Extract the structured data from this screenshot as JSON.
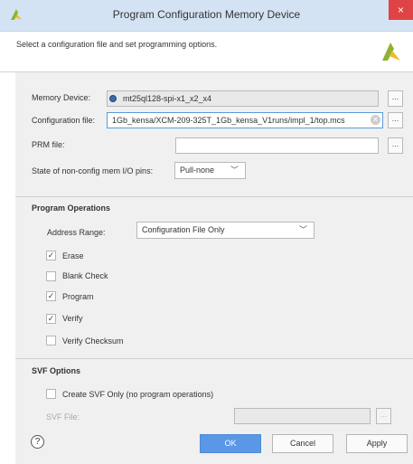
{
  "window": {
    "title": "Program Configuration Memory Device",
    "close_glyph": "×"
  },
  "header": {
    "subtitle": "Select a configuration file and set programming options."
  },
  "form": {
    "memory_device_label": "Memory Device:",
    "memory_device_value": "mt25ql128-spi-x1_x2_x4",
    "config_file_label": "Configuration file:",
    "config_file_value": "1Gb_kensa/XCM-209-325T_1Gb_kensa_V1runs/impl_1/top.mcs",
    "prm_file_label": "PRM file:",
    "prm_file_value": "",
    "state_pins_label": "State of non-config mem I/O pins:",
    "state_pins_value": "Pull-none",
    "browse_glyph": "..."
  },
  "program_operations": {
    "title": "Program Operations",
    "address_range_label": "Address Range:",
    "address_range_value": "Configuration File Only",
    "options": [
      {
        "label": "Erase",
        "checked": true
      },
      {
        "label": "Blank Check",
        "checked": false
      },
      {
        "label": "Program",
        "checked": true
      },
      {
        "label": "Verify",
        "checked": true
      },
      {
        "label": "Verify Checksum",
        "checked": false
      }
    ]
  },
  "svf_options": {
    "title": "SVF Options",
    "create_svf_label": "Create SVF Only (no program operations)",
    "svf_file_label": "SVF File:",
    "svf_file_value": ""
  },
  "buttons": {
    "help": "?",
    "ok": "OK",
    "cancel": "Cancel",
    "apply": "Apply"
  },
  "icons": {
    "app": "vivado-logo-icon",
    "memory": "gear-icon",
    "clear": "clear-icon",
    "dropdown": "chevron-down-icon"
  },
  "colors": {
    "title_bar": "#d4e3f3",
    "close_button": "#e04343",
    "ok_button": "#5a97e6",
    "logo_green": "#8cb431",
    "logo_yellow": "#f0b828"
  }
}
